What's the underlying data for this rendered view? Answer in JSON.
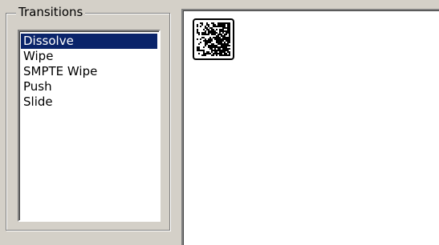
{
  "transitions_group": {
    "label": "Transitions",
    "items": [
      {
        "label": "Dissolve",
        "selected": true
      },
      {
        "label": "Wipe",
        "selected": false
      },
      {
        "label": "SMPTE Wipe",
        "selected": false
      },
      {
        "label": "Push",
        "selected": false
      },
      {
        "label": "Slide",
        "selected": false
      }
    ]
  },
  "preview": {
    "thumbnail_icon": "dissolve-noise-icon"
  },
  "colors": {
    "window_bg": "#d4d0c8",
    "selection_bg": "#0a246a",
    "selection_fg": "#ffffff"
  }
}
